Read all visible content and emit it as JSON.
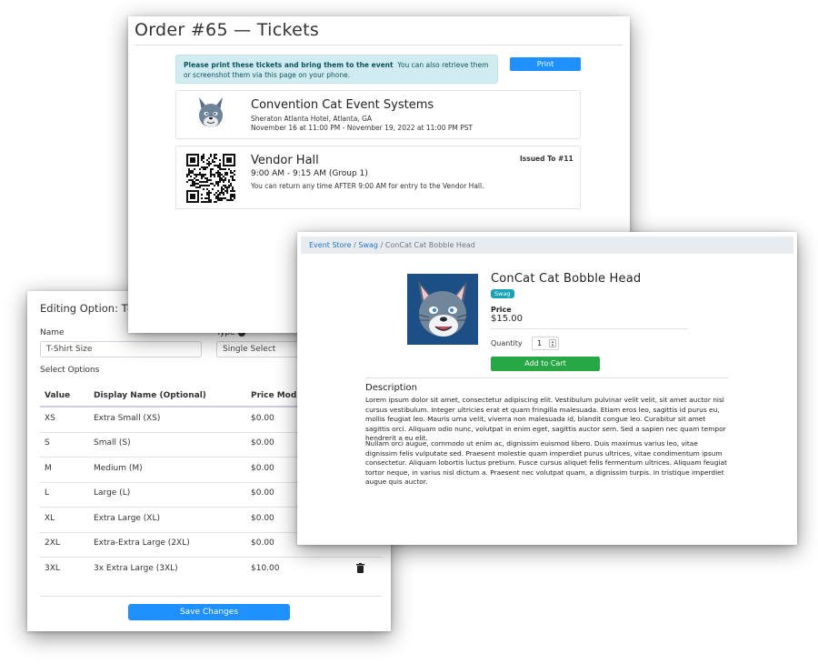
{
  "edit_panel": {
    "title": "Editing Option: T-Shirt Size",
    "name_label": "Name",
    "name_value": "T-Shirt Size",
    "type_label": "Type",
    "type_value": "Single Select",
    "select_options_label": "Select Options",
    "columns": [
      "Value",
      "Display Name (Optional)",
      "Price Modifi"
    ],
    "rows": [
      {
        "value": "XS",
        "display": "Extra Small (XS)",
        "price": "$0.00"
      },
      {
        "value": "S",
        "display": "Small (S)",
        "price": "$0.00"
      },
      {
        "value": "M",
        "display": "Medium (M)",
        "price": "$0.00"
      },
      {
        "value": "L",
        "display": "Large (L)",
        "price": "$0.00"
      },
      {
        "value": "XL",
        "display": "Extra Large (XL)",
        "price": "$0.00"
      },
      {
        "value": "2XL",
        "display": "Extra-Extra Large (2XL)",
        "price": "$0.00"
      },
      {
        "value": "3XL",
        "display": "3x Extra Large (3XL)",
        "price": "$10.00"
      }
    ],
    "save_label": "Save Changes"
  },
  "tickets_panel": {
    "title": "Order #65 — Tickets",
    "notice_bold": "Please print these tickets and bring them to the event",
    "notice_rest": "You can also retrieve them or screenshot them via this page on your phone.",
    "print_label": "Print",
    "event": {
      "name": "Convention Cat Event Systems",
      "location": "Sheraton Atlanta Hotel, Atlanta, GA",
      "dates": "November 16 at 11:00 PM - November 19, 2022 at 11:00 PM PST"
    },
    "ticket": {
      "name": "Vendor Hall",
      "time": "9:00 AM - 9:15 AM (Group 1)",
      "note": "You can return any time AFTER 9:00 AM for entry to the Vendor Hall.",
      "issued": "Issued To #11"
    }
  },
  "product_panel": {
    "breadcrumbs": [
      "Event Store",
      "Swag",
      "ConCat Cat Bobble Head"
    ],
    "name": "ConCat Cat Bobble Head",
    "badge": "Swag",
    "price_label": "Price",
    "price": "$15.00",
    "quantity_label": "Quantity",
    "quantity": "1",
    "add_label": "Add to Cart",
    "description_title": "Description",
    "paragraphs": [
      "Lorem ipsum dolor sit amet, consectetur adipiscing elit. Vestibulum pulvinar velit velit, sit amet auctor nisl cursus vestibulum. Integer ultricies erat et quam fringilla malesuada. Etiam eros leo, sagittis id purus eu, mollis feugiat leo. Mauris urna velit, viverra non malesuada id, blandit congue leo. Curabitur sit amet sagittis orci. Aliquam odio nunc, volutpat in enim eget, sagittis auctor sem. Sed a sapien nec quam tempor hendrerit a eu elit.",
      "Nullam orci augue, commodo ut enim ac, dignissim euismod libero. Duis maximus varius leo, vitae dignissim felis vulputate sed. Praesent molestie quam imperdiet purus ultrices, vitae condimentum ipsum consectetur. Aliquam lobortis luctus pretium. Fusce cursus aliquet felis fermentum ultrices. Aliquam feugiat tortor neque, in varius nisl dictum a. Praesent nec volutpat quam, a dignissim turpis. In tristique imperdiet augue quis auctor."
    ]
  },
  "colors": {
    "primary": "#1e90ff",
    "success": "#28a745",
    "info_badge": "#17a2b8",
    "notice_bg": "#d1ecf1",
    "logo_bg": "#1b4f86"
  }
}
